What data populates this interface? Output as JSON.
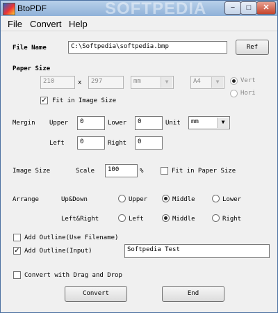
{
  "window": {
    "title": "BtoPDF",
    "watermark": "SOFTPEDIA",
    "minimize": "−",
    "maximize": "□",
    "close": "✕"
  },
  "menu": [
    "File",
    "Convert",
    "Help"
  ],
  "file": {
    "label": "File Name",
    "value": "C:\\Softpedia\\softpedia.bmp",
    "ref_button": "Ref"
  },
  "paper": {
    "label": "Paper Size",
    "width": "210",
    "x": "x",
    "height": "297",
    "unit": "mm",
    "size": "A4",
    "vert": "Vert",
    "hori": "Hori",
    "fit_label": "Fit in Image Size",
    "fit_checked": true
  },
  "margin": {
    "label": "Mergin",
    "upper_label": "Upper",
    "upper": "0",
    "lower_label": "Lower",
    "lower": "0",
    "unit_label": "Unit",
    "unit": "mm",
    "left_label": "Left",
    "left": "0",
    "right_label": "Right",
    "right": "0"
  },
  "image": {
    "label": "Image Size",
    "scale_label": "Scale",
    "scale": "100",
    "percent": "%",
    "fit_label": "Fit in Paper Size",
    "fit_checked": false
  },
  "arrange": {
    "label": "Arrange",
    "updown_label": "Up&Down",
    "upper": "Upper",
    "middle": "Middle",
    "lower": "Lower",
    "leftright_label": "Left&Right",
    "left": "Left",
    "middle2": "Middle",
    "right": "Right",
    "updown_selected": "Middle",
    "leftright_selected": "Middle"
  },
  "outline": {
    "filename_label": "Add Outline(Use Filename)",
    "filename_checked": false,
    "input_label": "Add Outline(Input)",
    "input_checked": true,
    "input_value": "Softpedia Test"
  },
  "dragdrop": {
    "label": "Convert with Drag and Drop",
    "checked": false
  },
  "buttons": {
    "convert": "Convert",
    "end": "End"
  }
}
